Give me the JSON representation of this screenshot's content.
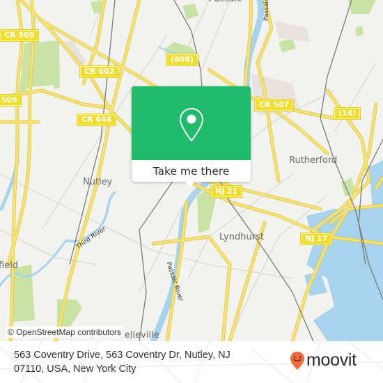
{
  "map": {
    "road_shields": [
      {
        "id": "cr509-top",
        "label": "CR 509"
      },
      {
        "id": "cr509-left",
        "label": "509"
      },
      {
        "id": "cr602",
        "label": "CR 602"
      },
      {
        "id": "cr644",
        "label": "CR 644"
      },
      {
        "id": "r608",
        "label": "(608)"
      },
      {
        "id": "cr507",
        "label": "CR 507"
      },
      {
        "id": "r14",
        "label": "(14)"
      },
      {
        "id": "nj21",
        "label": "NJ 21"
      },
      {
        "id": "nj17",
        "label": "NJ 17"
      }
    ],
    "places": [
      {
        "id": "passaic",
        "label": "Passaic"
      },
      {
        "id": "nutley",
        "label": "Nutley"
      },
      {
        "id": "rutherford",
        "label": "Rutherford"
      },
      {
        "id": "lyndhurst",
        "label": "Lyndhurst"
      },
      {
        "id": "bloomfield",
        "label": "field"
      },
      {
        "id": "belleville",
        "label": "Belleville"
      }
    ],
    "water_labels": [
      {
        "id": "passaic-river-south",
        "label": "Passaic River"
      },
      {
        "id": "passaic-river-north",
        "label": "Passaic"
      },
      {
        "id": "third-river",
        "label": "Third River"
      }
    ],
    "attribution": "© OpenStreetMap contributors",
    "colors": {
      "land": "#f2f2ef",
      "road": "#f5e064",
      "water": "#a8d3ec",
      "park": "#c9e3a5",
      "rail": "#777777"
    }
  },
  "popup": {
    "icon": "map-pin-icon",
    "button_label": "Take me there",
    "accent_color": "#1fba6a"
  },
  "footer": {
    "address_line1": "563 Coventry Drive, 563 Coventry Dr, Nutley, NJ",
    "address_line2": "07110, USA, New York City",
    "brand": "moovit",
    "brand_icon": "moovit-logo-icon",
    "brand_color": "#f26a3c"
  }
}
